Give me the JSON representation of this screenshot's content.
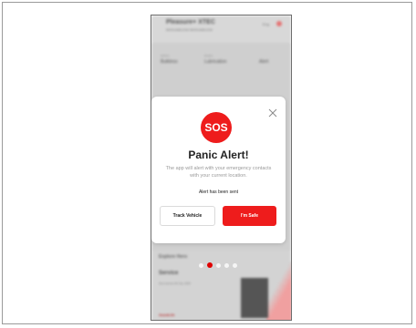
{
  "background": {
    "header_title": "Pleasure+ XTEC",
    "header_subtitle": "MH01AB1234 MH01AB1234",
    "language": "Eng",
    "stats": [
      {
        "caption": "Ignition",
        "value": "Bulkless"
      },
      {
        "caption": "Engine",
        "value": "Lubrication"
      },
      {
        "caption": "",
        "value": "Alert"
      }
    ],
    "explore_title": "Explore Hero",
    "service_title": "Service",
    "service_subtitle": "Next service 09 July, 2023",
    "brand": "GoodLife"
  },
  "modal": {
    "badge": "SOS",
    "title": "Panic Alert!",
    "message": "The app will alert with your emergency contacts with your current location.",
    "status": "Alert has been sent",
    "track_button": "Track Vehicle",
    "safe_button": "I'm Safe"
  },
  "pager": {
    "count": 5,
    "active_index": 1
  },
  "colors": {
    "accent": "#ee1c1c"
  }
}
